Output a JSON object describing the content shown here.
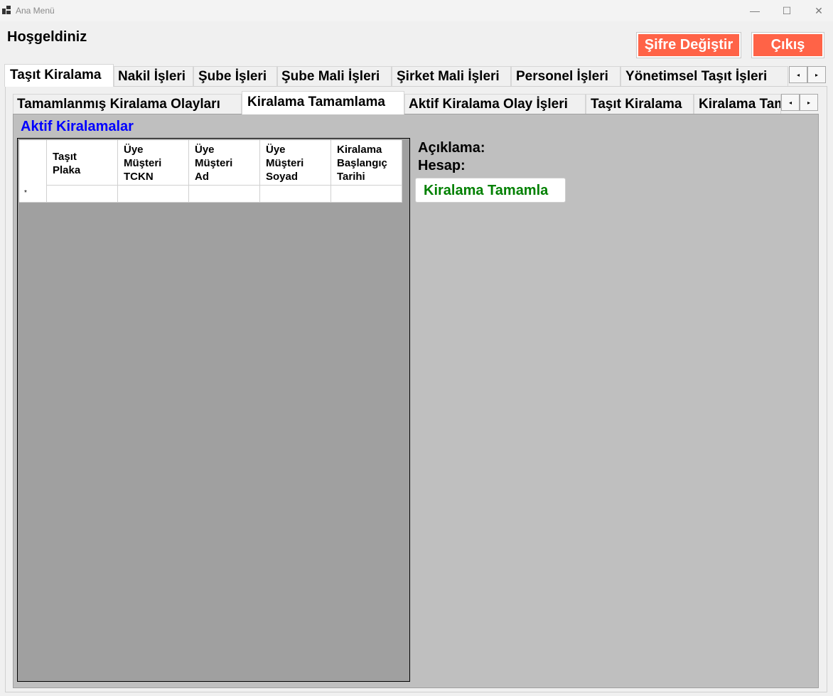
{
  "window": {
    "title": "Ana Menü",
    "controls": {
      "minimize": "—",
      "maximize": "☐",
      "close": "✕"
    }
  },
  "header": {
    "welcome": "Hoşgeldiniz",
    "change_password_label": "Şifre Değiştir",
    "exit_label": "Çıkış"
  },
  "main_tabs": [
    {
      "label": "Taşıt Kiralama"
    },
    {
      "label": "Nakil İşleri"
    },
    {
      "label": "Şube İşleri"
    },
    {
      "label": "Şube Mali İşleri"
    },
    {
      "label": "Şirket Mali İşleri"
    },
    {
      "label": "Personel İşleri"
    },
    {
      "label": "Yönetimsel Taşıt İşleri"
    }
  ],
  "sub_tabs": [
    {
      "label": "Tamamlanmış Kiralama Olayları"
    },
    {
      "label": "Kiralama Tamamlama"
    },
    {
      "label": "Aktif Kiralama Olay İşleri"
    },
    {
      "label": "Taşıt Kiralama"
    },
    {
      "label": "Kiralama Tamamlama"
    }
  ],
  "tab_scroll": {
    "left": "◂",
    "right": "▸"
  },
  "active_rentals": {
    "title": "Aktif Kiralamalar",
    "columns": [
      {
        "line1": "Taşıt",
        "line2": "Plaka",
        "line3": ""
      },
      {
        "line1": "Üye",
        "line2": "Müşteri",
        "line3": "TCKN"
      },
      {
        "line1": "Üye",
        "line2": "Müşteri",
        "line3": "Ad"
      },
      {
        "line1": "Üye",
        "line2": "Müşteri",
        "line3": "Soyad"
      },
      {
        "line1": "Kiralama",
        "line2": "Başlangıç",
        "line3": "Tarihi"
      }
    ],
    "new_row_marker": "*"
  },
  "details": {
    "description_label": "Açıklama:",
    "account_label": "Hesap:",
    "complete_button_label": "Kiralama Tamamla"
  },
  "colors": {
    "danger_button": "#ff6347",
    "section_title": "#0000ff",
    "complete_button_text": "#008000",
    "panel_background": "#bfbfbf",
    "grid_background": "#a0a0a0"
  }
}
